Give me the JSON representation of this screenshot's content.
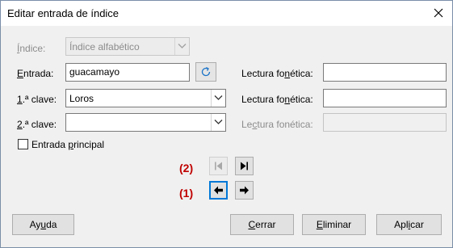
{
  "window": {
    "title": "Editar entrada de índice"
  },
  "form": {
    "indice": {
      "label_accel": "Í",
      "label_rest": "ndice:",
      "selected": "Índice alfabético"
    },
    "entrada": {
      "label_accel": "E",
      "label_rest": "ntrada:",
      "value": "guacamayo"
    },
    "clave1": {
      "label_accel": "1",
      "label_rest": ".ª clave:",
      "selected": "Loros"
    },
    "clave2": {
      "label_accel": "2",
      "label_rest": ".ª clave:",
      "selected": ""
    },
    "lectura1": {
      "label_pre": "Lectura fo",
      "label_accel": "n",
      "label_post": "ética:",
      "value": ""
    },
    "lectura2": {
      "label_pre": "Lectura fo",
      "label_accel": "n",
      "label_post": "ética:",
      "value": ""
    },
    "lectura3": {
      "label_pre": "Le",
      "label_accel": "c",
      "label_post": "tura fonética:",
      "value": ""
    },
    "entrada_principal": {
      "label_pre": "Entrada ",
      "label_accel": "p",
      "label_post": "rincipal",
      "checked": false
    }
  },
  "navigation": {
    "annotation_2": "(2)",
    "annotation_1": "(1)"
  },
  "buttons": {
    "help": {
      "pre": "Ay",
      "accel": "u",
      "post": "da"
    },
    "close": {
      "pre": "",
      "accel": "C",
      "post": "errar"
    },
    "delete": {
      "pre": "",
      "accel": "E",
      "post": "liminar"
    },
    "apply": {
      "pre": "Apl",
      "accel": "i",
      "post": "car"
    }
  },
  "icons": {
    "close": "close-icon",
    "update": "refresh-icon",
    "dropdown": "chevron-down-icon",
    "first": "skip-to-first-icon",
    "last": "skip-to-last-icon",
    "prev": "arrow-left-icon",
    "next": "arrow-right-icon"
  },
  "colors": {
    "annotation": "#c00000",
    "focus": "#0078d7",
    "refresh_icon": "#1a73c8"
  }
}
